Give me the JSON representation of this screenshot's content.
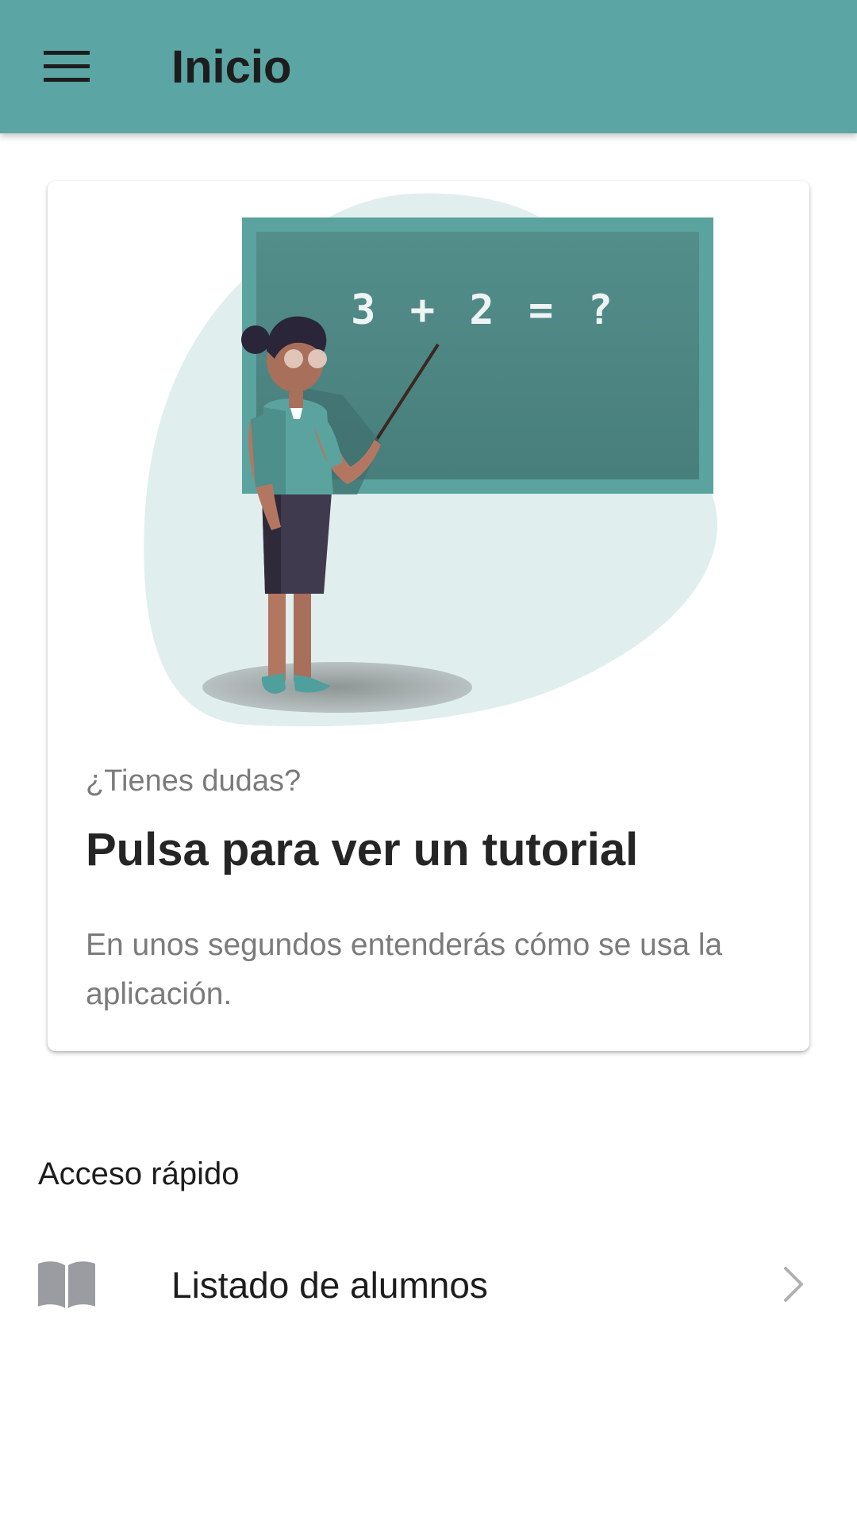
{
  "appbar": {
    "title": "Inicio",
    "menu_icon": "menu-icon"
  },
  "card": {
    "overline": "¿Tienes dudas?",
    "title": "Pulsa para ver un tutorial",
    "text": "En unos segundos entenderás cómo se usa la aplicación.",
    "illustration": {
      "chalkboard_text": "3 + 2 = ?"
    }
  },
  "quick_access": {
    "label": "Acceso rápido",
    "items": [
      {
        "label": "Listado de alumnos",
        "icon": "book-icon",
        "trailing_icon": "chevron-right-icon"
      }
    ]
  },
  "colors": {
    "primary": "#5ba5a5",
    "chalkboard_frame": "#5aa39f",
    "chalkboard": "#4e8a87",
    "blob": "#e1eeee"
  }
}
